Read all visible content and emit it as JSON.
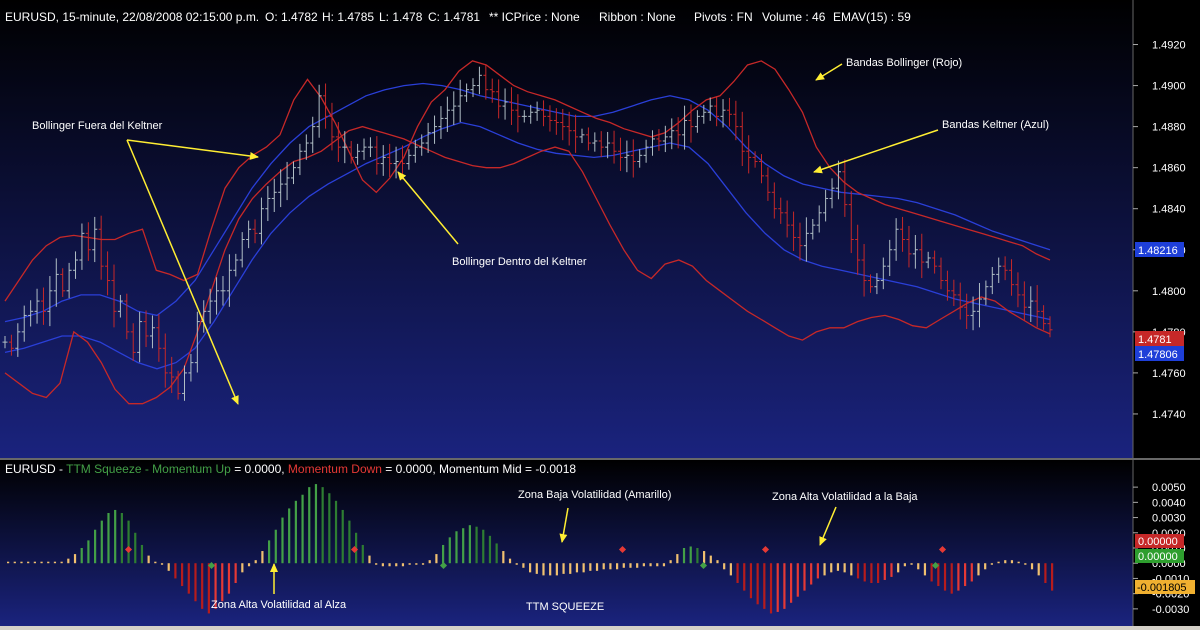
{
  "header": {
    "symbol_line": "EURUSD, 15-minute, 22/08/2008 02:15:00 p.m.",
    "o": "O: 1.4782",
    "h": "H: 1.4785",
    "l": "L: 1.478",
    "c": "C: 1.4781",
    "icprice": "** ICPrice : None",
    "ribbon": "Ribbon : None",
    "pivots": "Pivots : FN",
    "volume": "Volume : 46",
    "emav": "EMAV(15) : 59"
  },
  "lower_header": {
    "symbol": "EURUSD - ",
    "study": "TTM Squeeze - ",
    "mom_up_label": "Momentum Up",
    "mom_up_value": " = 0.0000, ",
    "mom_down_label": "Momentum Down",
    "mom_down_value": " = 0.0000, ",
    "mom_mid": "Momentum Mid = -0.0018"
  },
  "annotations": {
    "bollinger_fuera": "Bollinger Fuera del Keltner",
    "bollinger_dentro": "Bollinger Dentro del Keltner",
    "bandas_bollinger": "Bandas Bollinger (Rojo)",
    "bandas_keltner": "Bandas Keltner (Azul)",
    "zona_baja": "Zona Baja Volatilidad (Amarillo)",
    "zona_alta_baja": "Zona Alta Volatilidad a la Baja",
    "zona_alta_alza": "Zona Alta Volatilidad al Alza",
    "ttm_squeeze": "TTM SQUEEZE"
  },
  "price_badges": {
    "keltner_upper": "1.48216",
    "last_close": "1.4781",
    "keltner_lower": "1.47806"
  },
  "momentum_badges": {
    "red": "0.00000",
    "green": "0.00000",
    "yellow": "-0.001805"
  },
  "colors": {
    "bg_top": "#000000",
    "bg_bottom": "#1a237e",
    "bollinger": "#c62828",
    "keltner": "#2a3fd8",
    "bar_up": "#b0bec5",
    "bar_down": "#c62828",
    "mom_green": "#43a047",
    "mom_red": "#b71c1c",
    "mom_yellow": "#f0c070",
    "arrow": "#ffee33",
    "badge_blue": "#1e3fd8",
    "badge_red": "#c62828",
    "badge_green": "#2e9e2e",
    "badge_yellow": "#f0b030"
  },
  "chart_data": [
    {
      "type": "candlestick",
      "title": "EURUSD, 15-minute",
      "ylim": [
        1.472,
        1.493
      ],
      "y_ticks": [
        "1.4920",
        "1.4900",
        "1.4880",
        "1.4860",
        "1.4840",
        "1.4820",
        "1.4800",
        "1.4780",
        "1.4760",
        "1.4740"
      ],
      "close": [
        1.4775,
        1.4772,
        1.478,
        1.4788,
        1.479,
        1.4795,
        1.479,
        1.48,
        1.4808,
        1.48,
        1.481,
        1.4815,
        1.4828,
        1.482,
        1.483,
        1.4812,
        1.4805,
        1.479,
        1.4795,
        1.478,
        1.477,
        1.4785,
        1.4778,
        1.4782,
        1.4772,
        1.476,
        1.4758,
        1.475,
        1.476,
        1.4765,
        1.4785,
        1.479,
        1.4795,
        1.48,
        1.48,
        1.481,
        1.4815,
        1.4825,
        1.483,
        1.4828,
        1.484,
        1.4845,
        1.4848,
        1.4852,
        1.4855,
        1.486,
        1.4868,
        1.4872,
        1.488,
        1.4895,
        1.4885,
        1.4875,
        1.487,
        1.487,
        1.4865,
        1.4868,
        1.487,
        1.487,
        1.4862,
        1.4865,
        1.4862,
        1.4863,
        1.4862,
        1.4866,
        1.487,
        1.4872,
        1.4877,
        1.488,
        1.4884,
        1.4888,
        1.489,
        1.4895,
        1.4898,
        1.49,
        1.4905,
        1.4898,
        1.4897,
        1.489,
        1.4892,
        1.4888,
        1.4885,
        1.4885,
        1.4887,
        1.4888,
        1.4885,
        1.4883,
        1.4882,
        1.488,
        1.4878,
        1.4875,
        1.4876,
        1.4872,
        1.4873,
        1.487,
        1.4872,
        1.4868,
        1.4865,
        1.4866,
        1.4863,
        1.4866,
        1.487,
        1.4874,
        1.4873,
        1.4875,
        1.4878,
        1.4876,
        1.4883,
        1.488,
        1.4885,
        1.4887,
        1.489,
        1.4885,
        1.4888,
        1.4886,
        1.488,
        1.4868,
        1.4865,
        1.4863,
        1.4856,
        1.4848,
        1.484,
        1.4838,
        1.4832,
        1.4826,
        1.4822,
        1.4828,
        1.4832,
        1.4838,
        1.4845,
        1.485,
        1.4858,
        1.4842,
        1.4825,
        1.4815,
        1.4805,
        1.4802,
        1.4805,
        1.4812,
        1.482,
        1.483,
        1.4825,
        1.4818,
        1.482,
        1.4814,
        1.4816,
        1.4812,
        1.4805,
        1.48,
        1.4798,
        1.4792,
        1.4788,
        1.479,
        1.4796,
        1.4802,
        1.4808,
        1.4812,
        1.481,
        1.4803,
        1.4798,
        1.4792,
        1.4795,
        1.479,
        1.4784,
        1.4781
      ],
      "bollinger_upper": [
        1.4795,
        1.4805,
        1.4815,
        1.4822,
        1.4826,
        1.4827,
        1.4826,
        1.4825,
        1.4825,
        1.4828,
        1.483,
        1.481,
        1.4808,
        1.4805,
        1.4808,
        1.483,
        1.485,
        1.486,
        1.4866,
        1.487,
        1.4876,
        1.4893,
        1.4903,
        1.4894,
        1.4882,
        1.4868,
        1.4854,
        1.4848,
        1.4855,
        1.4865,
        1.488,
        1.4892,
        1.4898,
        1.4907,
        1.4912,
        1.491,
        1.4905,
        1.49,
        1.4897,
        1.4895,
        1.4893,
        1.489,
        1.4887,
        1.4884,
        1.4882,
        1.4879,
        1.4877,
        1.4875,
        1.4877,
        1.4882,
        1.4888,
        1.4893,
        1.4895,
        1.4902,
        1.491,
        1.4912,
        1.4908,
        1.4898,
        1.4887,
        1.487,
        1.486,
        1.4853,
        1.4848,
        1.4845,
        1.4842,
        1.484,
        1.4838,
        1.4836,
        1.4834,
        1.4832,
        1.483,
        1.4828,
        1.4826,
        1.4824,
        1.4822,
        1.4818,
        1.4815
      ],
      "bollinger_lower": [
        1.476,
        1.4755,
        1.475,
        1.4748,
        1.4755,
        1.478,
        1.4775,
        1.4765,
        1.4752,
        1.4745,
        1.4745,
        1.4748,
        1.4753,
        1.4762,
        1.478,
        1.48,
        1.482,
        1.4835,
        1.4845,
        1.4852,
        1.4858,
        1.4863,
        1.4865,
        1.4868,
        1.4873,
        1.4878,
        1.488,
        1.4878,
        1.4876,
        1.4874,
        1.4871,
        1.4868,
        1.4865,
        1.4863,
        1.4861,
        1.486,
        1.486,
        1.4862,
        1.4865,
        1.4868,
        1.487,
        1.4868,
        1.4858,
        1.4845,
        1.4832,
        1.482,
        1.481,
        1.4806,
        1.4813,
        1.4815,
        1.4812,
        1.4805,
        1.48,
        1.4795,
        1.479,
        1.4786,
        1.4782,
        1.4778,
        1.4776,
        1.478,
        1.4782,
        1.4782,
        1.4785,
        1.4787,
        1.4788,
        1.4786,
        1.4783,
        1.4782,
        1.4786,
        1.479,
        1.4794,
        1.4797,
        1.4795,
        1.479,
        1.4786,
        1.4782,
        1.4779
      ],
      "keltner_upper": [
        1.4785,
        1.4787,
        1.479,
        1.4795,
        1.4798,
        1.4798,
        1.4795,
        1.479,
        1.4788,
        1.4795,
        1.4805,
        1.482,
        1.4835,
        1.485,
        1.4862,
        1.4872,
        1.488,
        1.4885,
        1.489,
        1.4895,
        1.4898,
        1.49,
        1.4901,
        1.49,
        1.4898,
        1.4895,
        1.4893,
        1.4891,
        1.4889,
        1.4887,
        1.4885,
        1.4885,
        1.4887,
        1.489,
        1.4893,
        1.4895,
        1.4893,
        1.4888,
        1.488,
        1.487,
        1.4862,
        1.4856,
        1.4852,
        1.485,
        1.4848,
        1.4847,
        1.4846,
        1.4845,
        1.4843,
        1.484,
        1.4837,
        1.4833,
        1.4829,
        1.4826,
        1.4823,
        1.482
      ],
      "keltner_lower": [
        1.477,
        1.4772,
        1.4775,
        1.4778,
        1.4778,
        1.4775,
        1.477,
        1.4765,
        1.4762,
        1.4765,
        1.4772,
        1.4785,
        1.48,
        1.4815,
        1.4828,
        1.4838,
        1.4846,
        1.4852,
        1.4857,
        1.4862,
        1.4866,
        1.487,
        1.4875,
        1.4879,
        1.4882,
        1.488,
        1.4876,
        1.4872,
        1.4869,
        1.4867,
        1.4866,
        1.4865,
        1.4866,
        1.4868,
        1.487,
        1.4872,
        1.487,
        1.4862,
        1.485,
        1.4838,
        1.4828,
        1.482,
        1.4815,
        1.4812,
        1.481,
        1.4808,
        1.4806,
        1.4804,
        1.4802,
        1.4799,
        1.4796,
        1.4794,
        1.4792,
        1.479,
        1.4788,
        1.4786
      ]
    },
    {
      "type": "bar",
      "title": "TTM Squeeze",
      "ylim": [
        -0.0036,
        0.0056
      ],
      "y_ticks": [
        "0.0050",
        "0.0040",
        "0.0030",
        "0.0020",
        "0.0010",
        "0.0000",
        "-0.0010",
        "-0.0020",
        "-0.0030"
      ],
      "values": [
        0.0001,
        0.0001,
        0.0001,
        0.0001,
        0.0001,
        0.0001,
        0.0001,
        0.0001,
        0.0001,
        0.0003,
        0.0006,
        0.001,
        0.0015,
        0.0022,
        0.0028,
        0.0033,
        0.0035,
        0.0033,
        0.0028,
        0.002,
        0.0012,
        0.0005,
        0.0001,
        -0.0001,
        -0.0005,
        -0.001,
        -0.0015,
        -0.002,
        -0.0025,
        -0.003,
        -0.0033,
        -0.003,
        -0.0025,
        -0.002,
        -0.0013,
        -0.0006,
        -0.0002,
        0.0002,
        0.0008,
        0.0015,
        0.0022,
        0.003,
        0.0036,
        0.0041,
        0.0045,
        0.005,
        0.0052,
        0.005,
        0.0046,
        0.0041,
        0.0035,
        0.0028,
        0.002,
        0.0012,
        0.0005,
        -0.0001,
        -0.0002,
        -0.0002,
        -0.0002,
        -0.0002,
        -0.0001,
        -0.0001,
        -0.0001,
        0.0002,
        0.0006,
        0.0012,
        0.0017,
        0.0021,
        0.0023,
        0.0025,
        0.0024,
        0.0022,
        0.0018,
        0.0013,
        0.0008,
        0.0003,
        -0.0001,
        -0.0003,
        -0.0006,
        -0.0007,
        -0.0008,
        -0.0008,
        -0.0008,
        -0.0007,
        -0.0007,
        -0.0006,
        -0.0006,
        -0.0005,
        -0.0005,
        -0.0004,
        -0.0004,
        -0.0004,
        -0.0003,
        -0.0003,
        -0.0003,
        -0.0002,
        -0.0002,
        -0.0002,
        -0.0002,
        0.0002,
        0.0006,
        0.001,
        0.0011,
        0.001,
        0.0008,
        0.0005,
        0.0002,
        -0.0004,
        -0.0008,
        -0.0013,
        -0.0018,
        -0.0023,
        -0.0027,
        -0.003,
        -0.0033,
        -0.0032,
        -0.003,
        -0.0026,
        -0.0022,
        -0.0018,
        -0.0014,
        -0.001,
        -0.0008,
        -0.0006,
        -0.0005,
        -0.0006,
        -0.0008,
        -0.001,
        -0.0012,
        -0.0013,
        -0.0013,
        -0.0011,
        -0.0009,
        -0.0006,
        -0.0002,
        -0.0001,
        -0.0004,
        -0.0008,
        -0.0012,
        -0.0015,
        -0.0018,
        -0.002,
        -0.0018,
        -0.0015,
        -0.0012,
        -0.0008,
        -0.0004,
        -0.0001,
        0.0001,
        0.0002,
        0.0002,
        0.0001,
        -0.0001,
        -0.0004,
        -0.0008,
        -0.0013,
        -0.0018
      ]
    }
  ]
}
